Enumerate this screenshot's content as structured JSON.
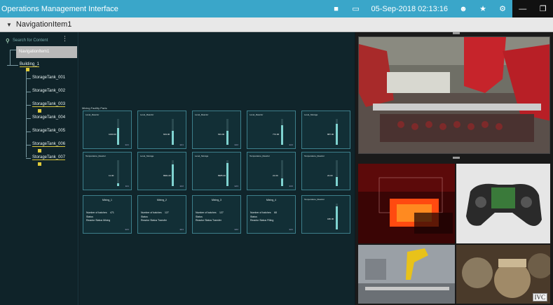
{
  "app": {
    "title": "Operations Management Interface",
    "datetime": "05-Sep-2018 02:13:16"
  },
  "icons": {
    "camera": "camera-icon",
    "monitor": "monitor-icon",
    "user": "user-icon",
    "star": "star-icon",
    "gear": "gear-icon",
    "minimize": "minimize-icon",
    "restore": "restore-icon"
  },
  "nav": {
    "breadcrumb": "NavigationItem1"
  },
  "sidebar": {
    "search_placeholder": "Search for Content",
    "selected": "NavigationItem1",
    "building": "Building_1",
    "tanks": [
      "StorageTank_001",
      "StorageTank_002",
      "StorageTank_003",
      "StorageTank_004",
      "StorageTank_005",
      "StorageTank_006",
      "StorageTank_007"
    ]
  },
  "center": {
    "title": "Mixing Facility Parts",
    "row1": [
      {
        "name": "Level_Reactor",
        "value": "1000.00",
        "id": "E21",
        "level": 0.65
      },
      {
        "name": "Level_Reactor",
        "value": "633.00",
        "id": "E41",
        "level": 0.55
      },
      {
        "name": "Level_Reactor",
        "value": "633.00",
        "id": "E22",
        "level": 0.55
      },
      {
        "name": "Level_Reactor",
        "value": "772.00",
        "id": "E24",
        "level": 0.75
      },
      {
        "name": "Level_Storage",
        "value": "887.00",
        "id": "",
        "level": 0.82
      }
    ],
    "row2": [
      {
        "name": "Temperature_Reactor",
        "value": "11.00",
        "id": "E11",
        "level": 0.1
      },
      {
        "name": "Level_Storage",
        "value": "8961.00",
        "id": "E42",
        "level": 0.85
      },
      {
        "name": "Level_Storage",
        "value": "8985.00",
        "id": "E43",
        "level": 0.88
      },
      {
        "name": "Temperature_Reactor",
        "value": "21.00",
        "id": "E34",
        "level": 0.3
      },
      {
        "name": "Temperature_Reactor",
        "value": "22.00",
        "id": "",
        "level": 0.35
      }
    ],
    "mixers": [
      {
        "title": "Mixing_1",
        "batches_label": "Number of batches",
        "batches": "471",
        "status_label": "Status",
        "status": "Reactor Status Mixing",
        "id": "E21"
      },
      {
        "title": "Mixing_2",
        "batches_label": "Number of batches",
        "batches": "127",
        "status_label": "Status",
        "status": "Reactor Status Transfer",
        "id": "E41"
      },
      {
        "title": "Mixing_3",
        "batches_label": "Number of batches",
        "batches": "127",
        "status_label": "Status",
        "status": "Reactor Status Transfer",
        "id": "E42"
      },
      {
        "title": "Mixing_4",
        "batches_label": "Number of batches",
        "batches": "68",
        "status_label": "Status",
        "status": "Reactor Status Filling",
        "id": "E21"
      }
    ],
    "temp_card": {
      "name": "Temperature_Reactor",
      "value": "180.00",
      "level": 0.9
    }
  },
  "video": {
    "watermark": "IVC"
  },
  "colors": {
    "accent": "#3aa6c9",
    "card_border": "#3d7f8b",
    "fill": "#7fd3d0",
    "badge": "#e0cc3a"
  }
}
